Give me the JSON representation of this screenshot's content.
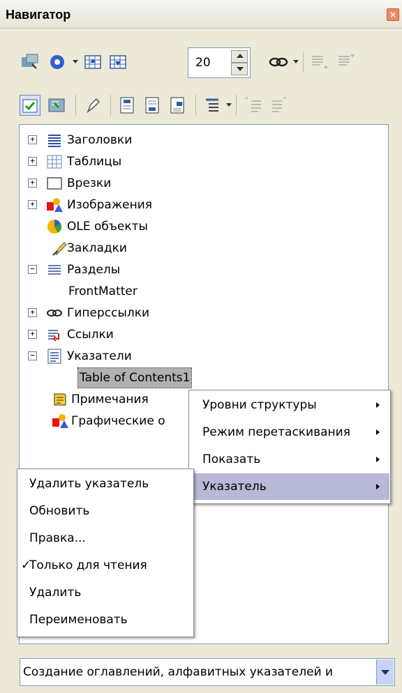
{
  "window": {
    "title": "Навигатор",
    "close_glyph": "×"
  },
  "toolbar1": {
    "buttons": [
      "content-view-icon",
      "navigation-icon",
      "previous-icon",
      "next-icon",
      "drag-mode-icon",
      "promote-icon",
      "demote-icon"
    ],
    "spin_value": "20"
  },
  "toolbar2": {
    "buttons": [
      "toggle-icon",
      "anchor-icon",
      "reminder-icon",
      "header-icon",
      "footer-icon",
      "anchor-endnote-icon",
      "heading-levels-icon",
      "promote-level-icon",
      "demote-level-icon"
    ]
  },
  "tree": {
    "items": [
      {
        "label": "Заголовки",
        "icon": "headings-icon",
        "expander": "+"
      },
      {
        "label": "Таблицы",
        "icon": "tables-icon",
        "expander": "+"
      },
      {
        "label": "Врезки",
        "icon": "frames-icon",
        "expander": "+"
      },
      {
        "label": "Изображения",
        "icon": "images-icon",
        "expander": "+"
      },
      {
        "label": "OLE объекты",
        "icon": "ole-objects-icon",
        "expander": ""
      },
      {
        "label": "Закладки",
        "icon": "bookmarks-icon",
        "expander": ""
      },
      {
        "label": "Разделы",
        "icon": "sections-icon",
        "expander": "−"
      },
      {
        "label": "FrontMatter",
        "icon": "",
        "expander": ""
      },
      {
        "label": "Гиперссылки",
        "icon": "hyperlinks-icon",
        "expander": "+"
      },
      {
        "label": "Ссылки",
        "icon": "references-icon",
        "expander": "+"
      },
      {
        "label": "Указатели",
        "icon": "indexes-icon",
        "expander": "−"
      },
      {
        "label": "Table of Contents1",
        "icon": "",
        "expander": ""
      },
      {
        "label": "Примечания",
        "icon": "comments-icon",
        "expander": ""
      },
      {
        "label": "Графические о",
        "icon": "drawing-objects-icon",
        "expander": ""
      }
    ]
  },
  "submenu": {
    "items": [
      {
        "label": "Уровни структуры"
      },
      {
        "label": "Режим перетаскивания"
      },
      {
        "label": "Показать"
      },
      {
        "label": "Указатель"
      }
    ]
  },
  "context_menu": {
    "items": [
      {
        "label": "Удалить указатель"
      },
      {
        "label": "Обновить"
      },
      {
        "label": "Правка..."
      },
      {
        "label": "Только для чтения",
        "checked": true
      },
      {
        "label": "Удалить"
      },
      {
        "label": "Переименовать"
      }
    ],
    "check_glyph": "✓"
  },
  "document_select": {
    "value": "Создание оглавлений, алфавитных указателей и"
  }
}
